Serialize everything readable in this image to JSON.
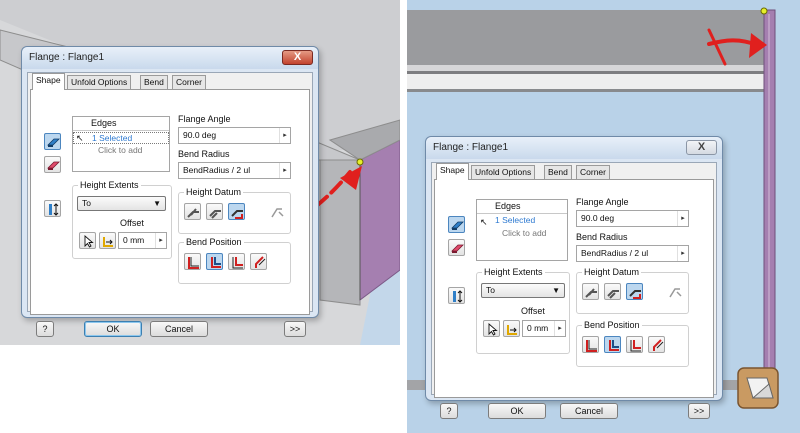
{
  "dialog": {
    "title": "Flange : Flange1",
    "close_symbol": "X",
    "tabs": [
      "Shape",
      "Unfold Options",
      "Bend",
      "Corner"
    ],
    "active_tab": "Shape",
    "edges": {
      "header": "Edges",
      "selected": "1 Selected",
      "hint": "Click to add"
    },
    "flange_angle": {
      "label": "Flange Angle",
      "value": "90.0 deg",
      "arrow": "▸"
    },
    "bend_radius": {
      "label": "Bend Radius",
      "value": "BendRadius / 2 ul",
      "arrow": "▸"
    },
    "height_extents": {
      "label": "Height Extents",
      "value": "To",
      "caret": "▼"
    },
    "offset": {
      "label": "Offset",
      "value": "0 mm",
      "arrow": "▸"
    },
    "height_datum": {
      "label": "Height Datum"
    },
    "bend_position": {
      "label": "Bend Position"
    },
    "buttons": {
      "help": "?",
      "ok": "OK",
      "cancel": "Cancel",
      "more": ">>"
    }
  },
  "colors": {
    "flange_face": "#a57fb0",
    "annotation_red": "#e0201e",
    "viewport_blue": "#b9d2e8",
    "selected_text": "#2e7ad1"
  }
}
